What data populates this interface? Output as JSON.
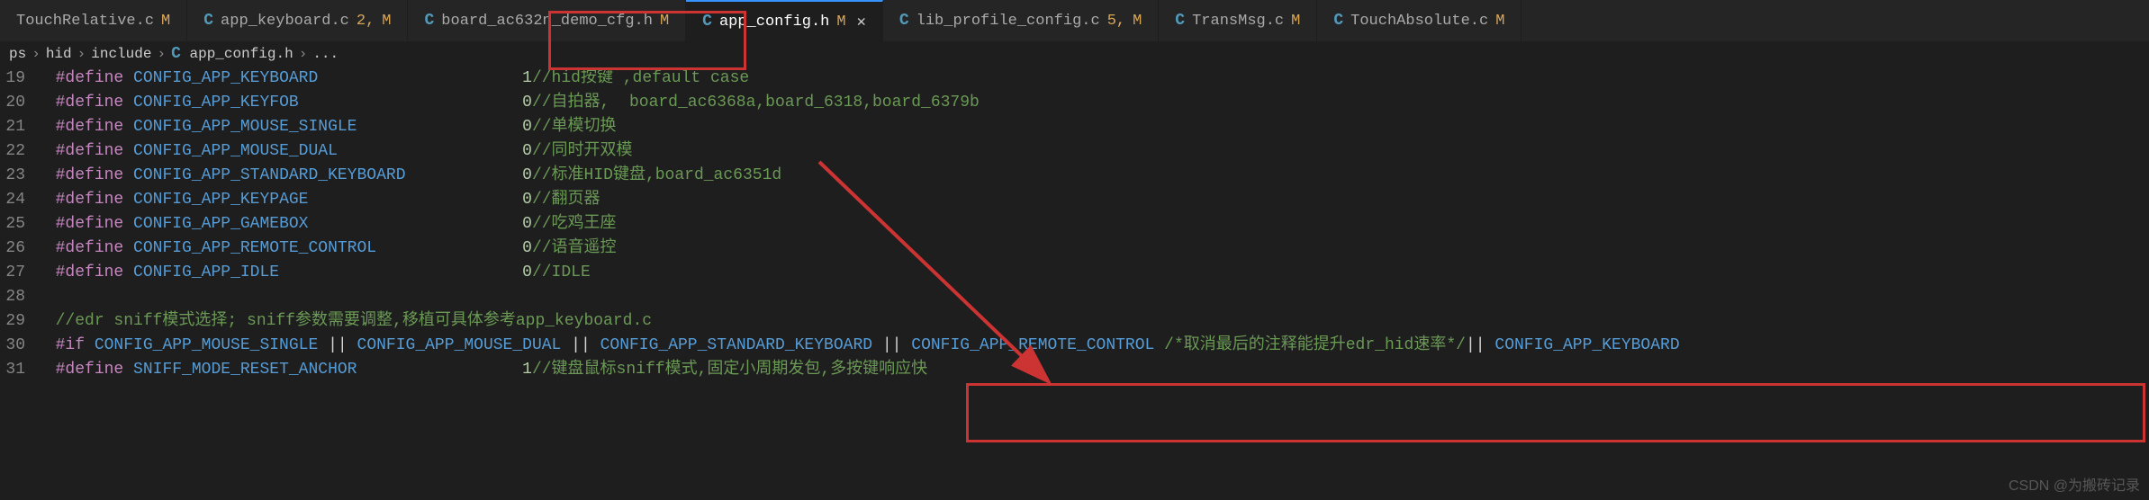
{
  "tabs": [
    {
      "name": "TouchRelative.c",
      "suffix": "M",
      "suffix2": ""
    },
    {
      "name": "app_keyboard.c",
      "suffix": "2,",
      "suffix2": "M"
    },
    {
      "name": "board_ac632n_demo_cfg.h",
      "suffix": "M",
      "suffix2": ""
    },
    {
      "name": "app_config.h",
      "suffix": "M",
      "suffix2": "",
      "active": true,
      "close": "✕"
    },
    {
      "name": "lib_profile_config.c",
      "suffix": "5,",
      "suffix2": "M"
    },
    {
      "name": "TransMsg.c",
      "suffix": "M",
      "suffix2": ""
    },
    {
      "name": "TouchAbsolute.c",
      "suffix": "M",
      "suffix2": ""
    }
  ],
  "breadcrumb": {
    "p1": "ps",
    "p2": "hid",
    "p3": "include",
    "p4": "app_config.h",
    "p5": "...",
    "sep": "›"
  },
  "lines": [
    {
      "n": "19",
      "pp": "#define",
      "mac": "CONFIG_APP_KEYBOARD",
      "val": "1",
      "com": "//hid按键 ,default case"
    },
    {
      "n": "20",
      "pp": "#define",
      "mac": "CONFIG_APP_KEYFOB",
      "val": "0",
      "com": "//自拍器,  board_ac6368a,board_6318,board_6379b"
    },
    {
      "n": "21",
      "pp": "#define",
      "mac": "CONFIG_APP_MOUSE_SINGLE",
      "val": "0",
      "com": "//单模切换"
    },
    {
      "n": "22",
      "pp": "#define",
      "mac": "CONFIG_APP_MOUSE_DUAL",
      "val": "0",
      "com": "//同时开双模"
    },
    {
      "n": "23",
      "pp": "#define",
      "mac": "CONFIG_APP_STANDARD_KEYBOARD",
      "val": "0",
      "com": "//标准HID键盘,board_ac6351d"
    },
    {
      "n": "24",
      "pp": "#define",
      "mac": "CONFIG_APP_KEYPAGE",
      "val": "0",
      "com": "//翻页器"
    },
    {
      "n": "25",
      "pp": "#define",
      "mac": "CONFIG_APP_GAMEBOX",
      "val": "0",
      "com": "//吃鸡王座"
    },
    {
      "n": "26",
      "pp": "#define",
      "mac": "CONFIG_APP_REMOTE_CONTROL",
      "val": "0",
      "com": "//语音遥控"
    },
    {
      "n": "27",
      "pp": "#define",
      "mac": "CONFIG_APP_IDLE",
      "val": "0",
      "com": "//IDLE"
    },
    {
      "n": "28",
      "blank": true
    },
    {
      "n": "29",
      "comline": "//edr sniff模式选择; sniff参数需要调整,移植可具体参考app_keyboard.c"
    },
    {
      "n": "30",
      "ifline": true,
      "pp": "#if",
      "m1": "CONFIG_APP_MOUSE_SINGLE",
      "m2": "CONFIG_APP_MOUSE_DUAL",
      "m3": "CONFIG_APP_STANDARD_KEYBOARD",
      "m4": "CONFIG_APP_REMOTE_CONTROL",
      "cblk": "/*取消最后的注释能提升edr_hid速率*/",
      "m5": "CONFIG_APP_KEYBOARD"
    },
    {
      "n": "31",
      "pp": "#define",
      "mac": "SNIFF_MODE_RESET_ANCHOR",
      "val": "1",
      "com": "//键盘鼠标sniff模式,固定小周期发包,多按键响应快"
    }
  ],
  "watermark": "CSDN @为搬砖记录",
  "icon_label": "C"
}
